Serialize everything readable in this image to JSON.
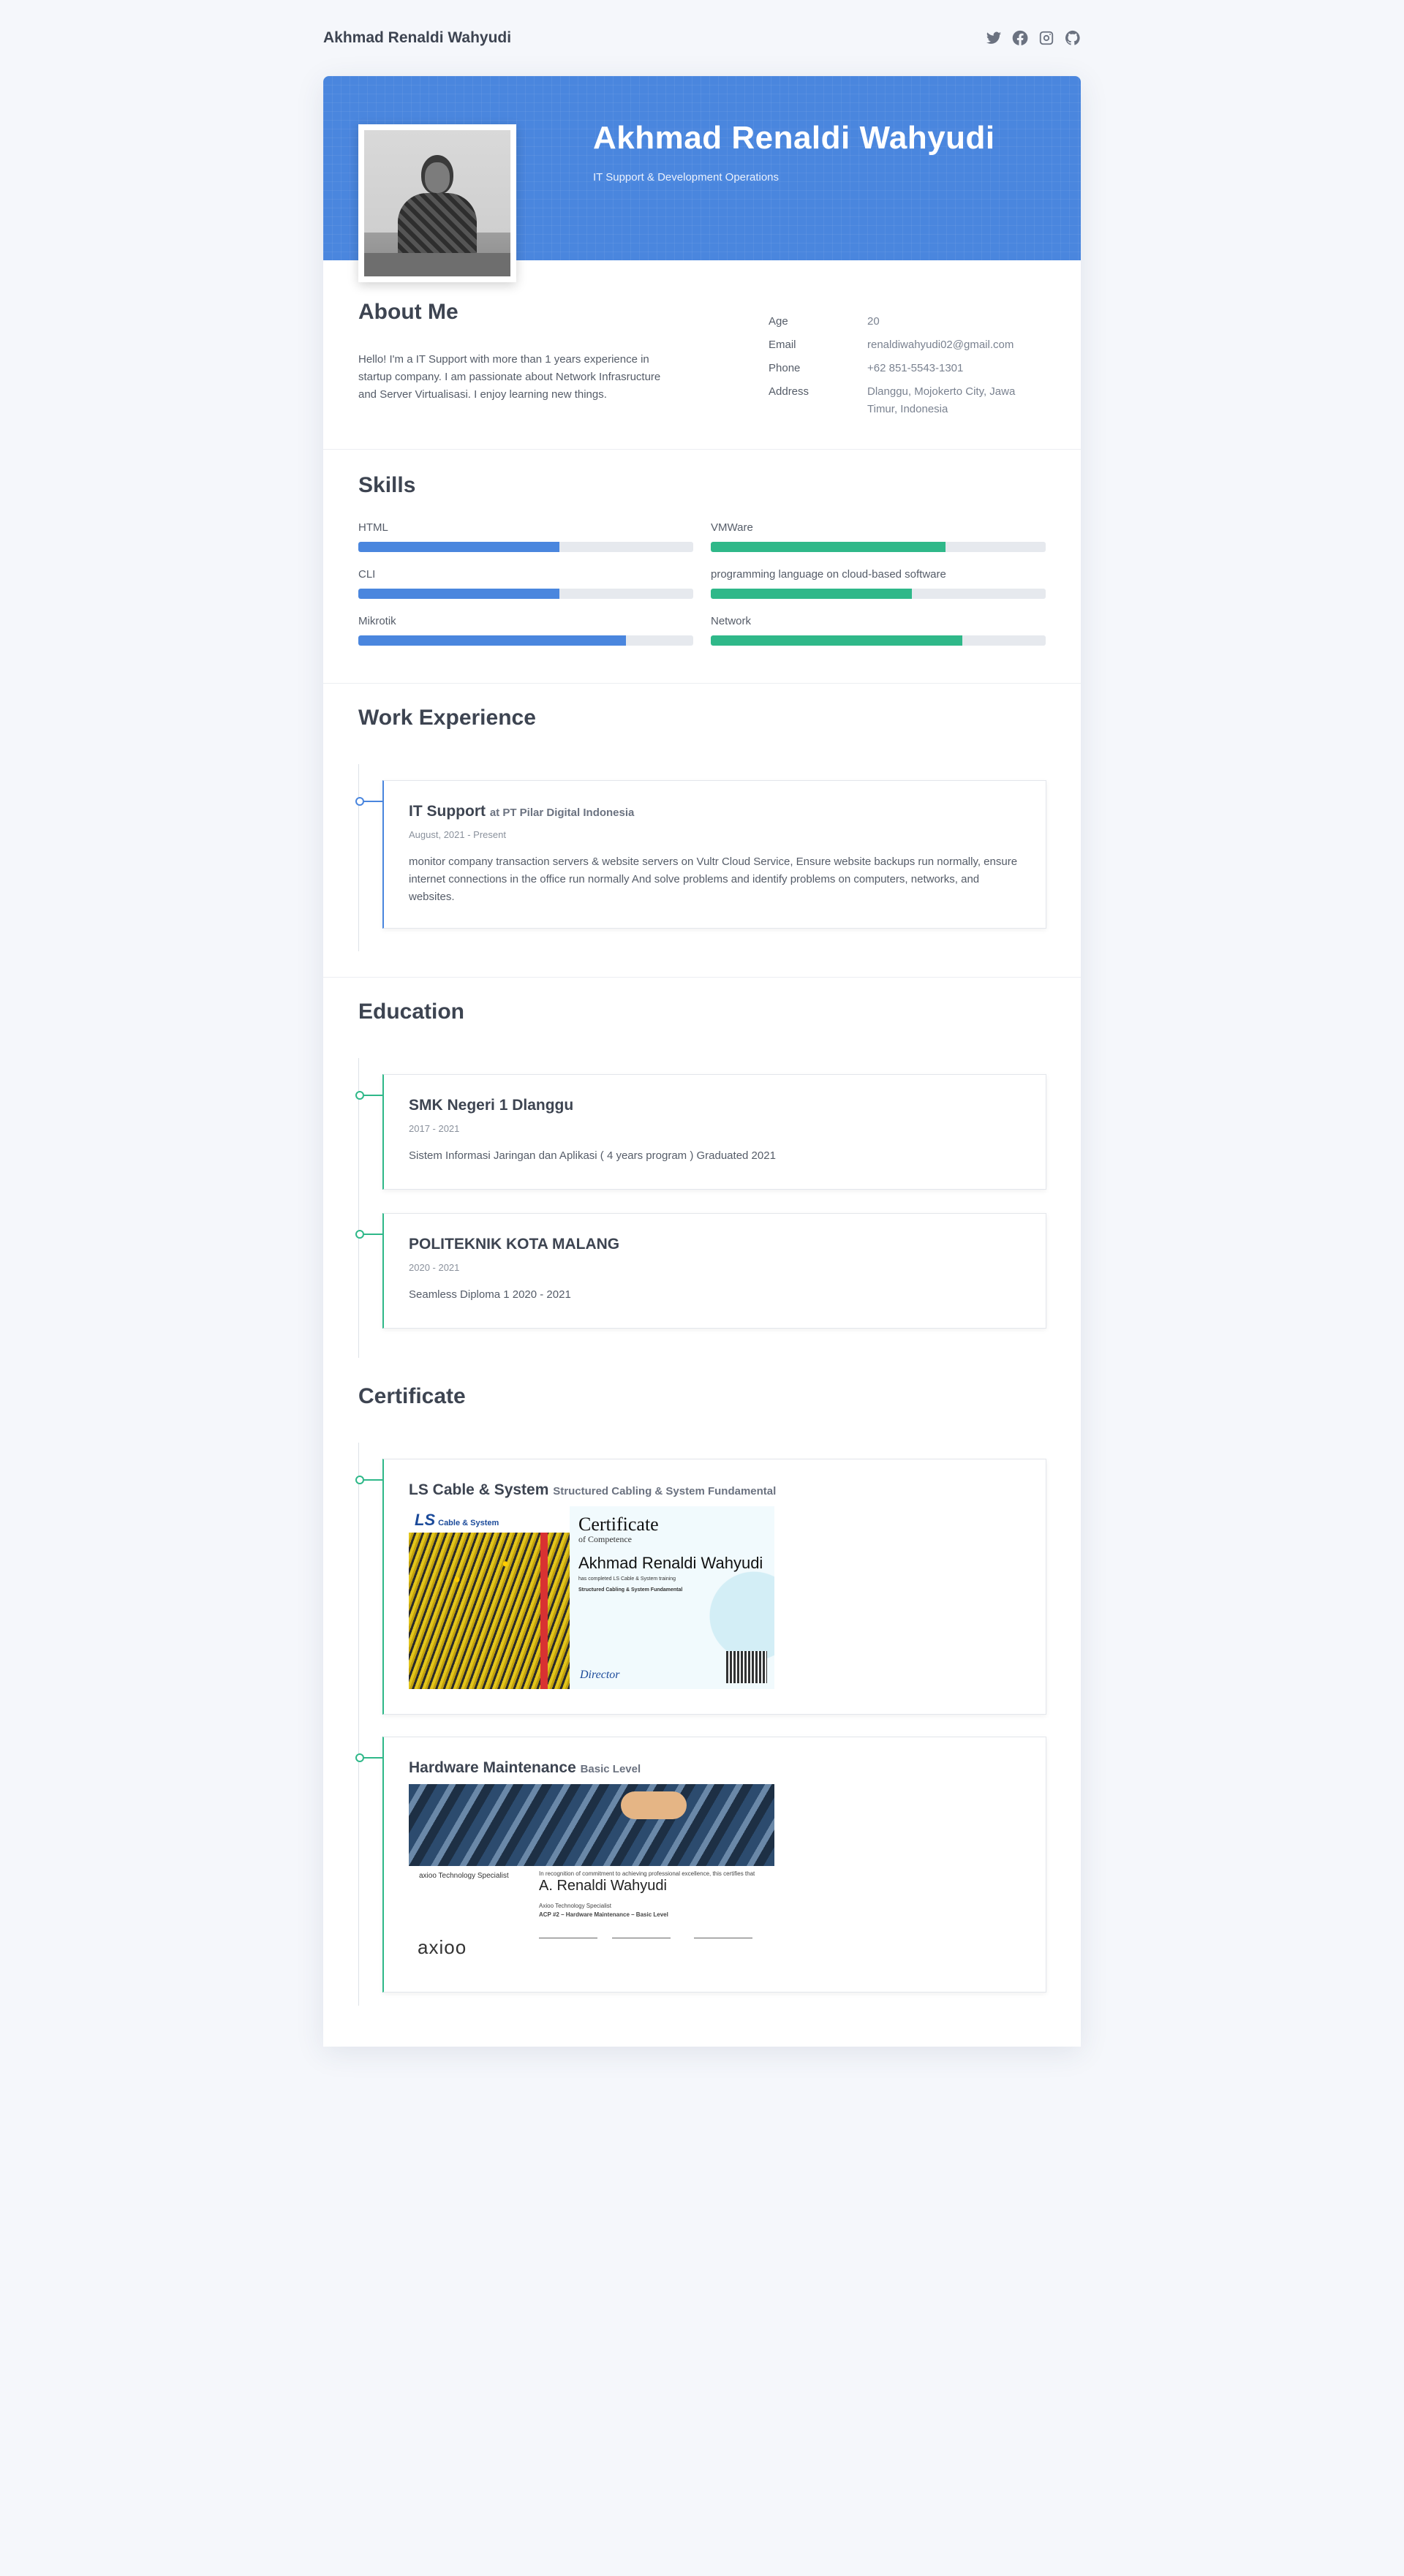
{
  "nav": {
    "brand": "Akhmad Renaldi Wahyudi",
    "social": [
      "twitter-icon",
      "facebook-icon",
      "instagram-icon",
      "github-icon"
    ]
  },
  "hero": {
    "name": "Akhmad Renaldi Wahyudi",
    "role": "IT Support & Development Operations"
  },
  "about": {
    "title": "About Me",
    "text": "Hello! I'm a IT Support with more than 1 years experience in startup company. I am passionate about Network Infrasructure and Server Virtualisasi. I enjoy learning new things.",
    "info": [
      {
        "label": "Age",
        "value": "20"
      },
      {
        "label": "Email",
        "value": "renaldiwahyudi02@gmail.com"
      },
      {
        "label": "Phone",
        "value": "+62 851-5543-1301"
      },
      {
        "label": "Address",
        "value": "Dlanggu, Mojokerto City, Jawa Timur, Indonesia"
      }
    ]
  },
  "skills": {
    "title": "Skills",
    "items": [
      {
        "label": "HTML",
        "level": 60,
        "color": "#4a86de"
      },
      {
        "label": "VMWare",
        "level": 70,
        "color": "#2fb889"
      },
      {
        "label": "CLI",
        "level": 60,
        "color": "#4a86de"
      },
      {
        "label": "programming language on cloud-based software",
        "level": 60,
        "color": "#2fb889"
      },
      {
        "label": "Mikrotik",
        "level": 80,
        "color": "#4a86de"
      },
      {
        "label": "Network",
        "level": 75,
        "color": "#2fb889"
      }
    ]
  },
  "work": {
    "title": "Work Experience",
    "items": [
      {
        "role": "IT Support",
        "company": "at PT Pilar Digital Indonesia",
        "date": "August, 2021 - Present",
        "desc": "monitor company transaction servers & website servers on Vultr Cloud Service, Ensure website backups run normally, ensure internet connections in the office run normally And solve problems and identify problems on computers, networks, and websites."
      }
    ]
  },
  "education": {
    "title": "Education",
    "items": [
      {
        "school": "SMK Negeri 1 Dlanggu",
        "date": "2017 - 2021",
        "desc": "Sistem Informasi Jaringan dan Aplikasi ( 4 years program ) Graduated 2021"
      },
      {
        "school": "POLITEKNIK KOTA MALANG",
        "date": "2020 - 2021",
        "desc": "Seamless Diploma 1 2020 - 2021"
      }
    ]
  },
  "certificates": {
    "title": "Certificate",
    "items": [
      {
        "title": "LS Cable & System",
        "sub": "Structured Cabling & System Fundamental",
        "image": {
          "logo": "LS",
          "logo_sub": "Cable & System",
          "heading": "Certificate",
          "subheading": "of Competence",
          "name": "Akhmad Renaldi Wahyudi",
          "line1": "has completed LS Cable & System training",
          "line2": "Structured Cabling & System Fundamental"
        }
      },
      {
        "title": "Hardware Maintenance",
        "sub": "Basic Level",
        "image": {
          "brand": "axioo Technology Specialist",
          "name": "A. Renaldi Wahyudi",
          "line1": "In recognition of commitment to achieving professional excellence, this certifies that",
          "line2": "Axioo Technology Specialist",
          "line3": "ACP #2 – Hardware Maintenance – Basic Level",
          "logo": "axioo"
        }
      }
    ]
  }
}
